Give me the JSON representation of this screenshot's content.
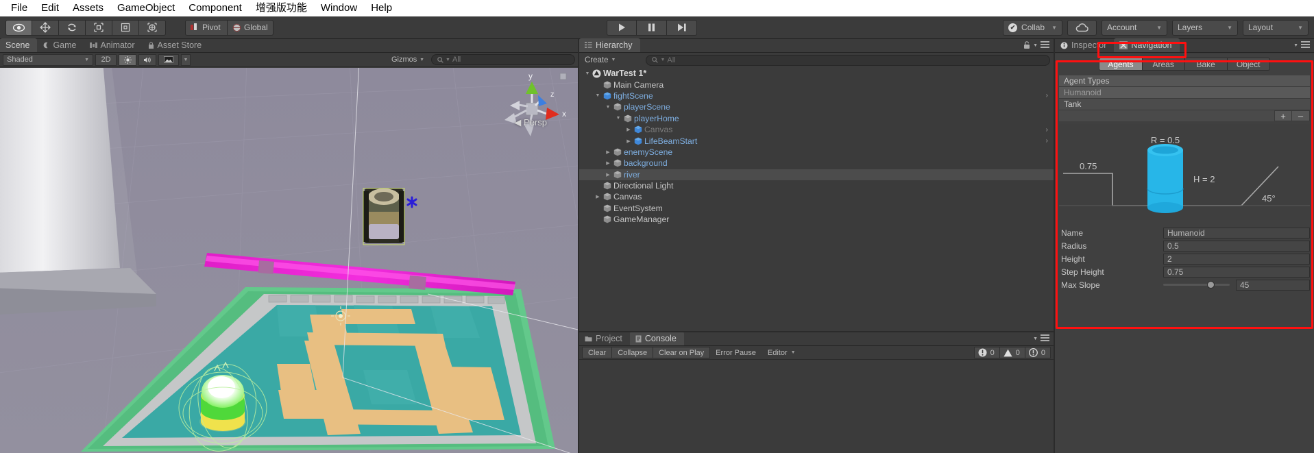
{
  "menu": {
    "items": [
      "File",
      "Edit",
      "Assets",
      "GameObject",
      "Component",
      "增强版功能",
      "Window",
      "Help"
    ]
  },
  "toolbar": {
    "tools": [
      {
        "name": "hand-tool",
        "glyph": "✋"
      },
      {
        "name": "move-tool",
        "glyph": "✚"
      },
      {
        "name": "rotate-tool",
        "glyph": "↻"
      },
      {
        "name": "scale-tool",
        "glyph": "⤡"
      },
      {
        "name": "rect-tool",
        "glyph": "□"
      },
      {
        "name": "transform-tool",
        "glyph": "✥"
      }
    ],
    "pivot_label": "Pivot",
    "global_label": "Global",
    "play_label": "▶",
    "pause_label": "‖",
    "step_label": "▶|",
    "collab_label": "Collab",
    "cloud_label": "☁",
    "account_label": "Account",
    "layers_label": "Layers",
    "layout_label": "Layout"
  },
  "scene_panel": {
    "tabs": [
      {
        "label": "Scene",
        "active": true
      },
      {
        "label": "Game",
        "active": false
      },
      {
        "label": "Animator",
        "active": false
      },
      {
        "label": "Asset Store",
        "active": false
      }
    ],
    "shading_mode": "Shaded",
    "mode_2d": "2D",
    "lighting_icon": "☀",
    "audio_icon": "ᴘ",
    "fx_icon": "◰",
    "gizmos_label": "Gizmos",
    "search_placeholder": "All",
    "perspective_label": "Persp",
    "axis_x": "x",
    "axis_y": "y",
    "axis_z": "z"
  },
  "hierarchy": {
    "tab_label": "Hierarchy",
    "create_label": "Create",
    "search_placeholder": "All",
    "tree": [
      {
        "label": "WarTest 1*",
        "depth": 0,
        "arrow": "down",
        "icon": "unity",
        "style": "root",
        "chev": false,
        "selected": false
      },
      {
        "label": "Main Camera",
        "depth": 1,
        "arrow": "none",
        "icon": "cube",
        "style": "normal",
        "chev": false,
        "selected": false
      },
      {
        "label": "fightScene",
        "depth": 1,
        "arrow": "down",
        "icon": "prefab",
        "style": "blue",
        "chev": true,
        "selected": false
      },
      {
        "label": "playerScene",
        "depth": 2,
        "arrow": "down",
        "icon": "cube",
        "style": "blue",
        "chev": false,
        "selected": false
      },
      {
        "label": "playerHome",
        "depth": 3,
        "arrow": "down",
        "icon": "cube",
        "style": "blue",
        "chev": false,
        "selected": false
      },
      {
        "label": "Canvas",
        "depth": 4,
        "arrow": "right",
        "icon": "prefab",
        "style": "dim",
        "chev": true,
        "selected": false
      },
      {
        "label": "LifeBeamStart",
        "depth": 4,
        "arrow": "right",
        "icon": "prefab",
        "style": "blue",
        "chev": true,
        "selected": false
      },
      {
        "label": "enemyScene",
        "depth": 2,
        "arrow": "right",
        "icon": "cube",
        "style": "blue",
        "chev": false,
        "selected": false
      },
      {
        "label": "background",
        "depth": 2,
        "arrow": "right",
        "icon": "cube",
        "style": "blue",
        "chev": false,
        "selected": false
      },
      {
        "label": "river",
        "depth": 2,
        "arrow": "right",
        "icon": "cube",
        "style": "blue",
        "chev": false,
        "selected": true
      },
      {
        "label": "Directional Light",
        "depth": 1,
        "arrow": "none",
        "icon": "cube",
        "style": "normal",
        "chev": false,
        "selected": false
      },
      {
        "label": "Canvas",
        "depth": 1,
        "arrow": "right",
        "icon": "cube",
        "style": "normal",
        "chev": false,
        "selected": false
      },
      {
        "label": "EventSystem",
        "depth": 1,
        "arrow": "none",
        "icon": "cube",
        "style": "normal",
        "chev": false,
        "selected": false
      },
      {
        "label": "GameManager",
        "depth": 1,
        "arrow": "none",
        "icon": "cube",
        "style": "normal",
        "chev": false,
        "selected": false
      }
    ]
  },
  "console": {
    "tabs": [
      {
        "label": "Project",
        "active": false
      },
      {
        "label": "Console",
        "active": true
      }
    ],
    "clear_label": "Clear",
    "collapse_label": "Collapse",
    "clear_on_play_label": "Clear on Play",
    "error_pause_label": "Error Pause",
    "editor_label": "Editor",
    "counts": {
      "info": "0",
      "warning": "0",
      "error": "0"
    }
  },
  "inspector": {
    "tabs": [
      {
        "label": "Inspector",
        "active": false,
        "icon": "info-icon"
      },
      {
        "label": "Navigation",
        "active": true,
        "icon": "navigation-icon"
      }
    ],
    "subtabs": [
      {
        "label": "Agents",
        "active": true
      },
      {
        "label": "Areas",
        "active": false
      },
      {
        "label": "Bake",
        "active": false
      },
      {
        "label": "Object",
        "active": false
      }
    ],
    "agent_types_header": "Agent Types",
    "agent_types": [
      {
        "label": "Humanoid",
        "selected": true
      },
      {
        "label": "Tank",
        "selected": false
      }
    ],
    "add_label": "+",
    "remove_label": "–",
    "diagram": {
      "radius_label": "R = 0.5",
      "height_label": "H = 2",
      "step_label": "0.75",
      "slope_label": "45°",
      "cylinder_color": "#27b6e8"
    },
    "properties": [
      {
        "label": "Name",
        "value": "Humanoid",
        "type": "text"
      },
      {
        "label": "Radius",
        "value": "0.5",
        "type": "text"
      },
      {
        "label": "Height",
        "value": "2",
        "type": "text"
      },
      {
        "label": "Step Height",
        "value": "0.75",
        "type": "text"
      },
      {
        "label": "Max Slope",
        "value": "45",
        "type": "slider"
      }
    ]
  },
  "annotation": {
    "highlight_color": "#ff1010"
  }
}
